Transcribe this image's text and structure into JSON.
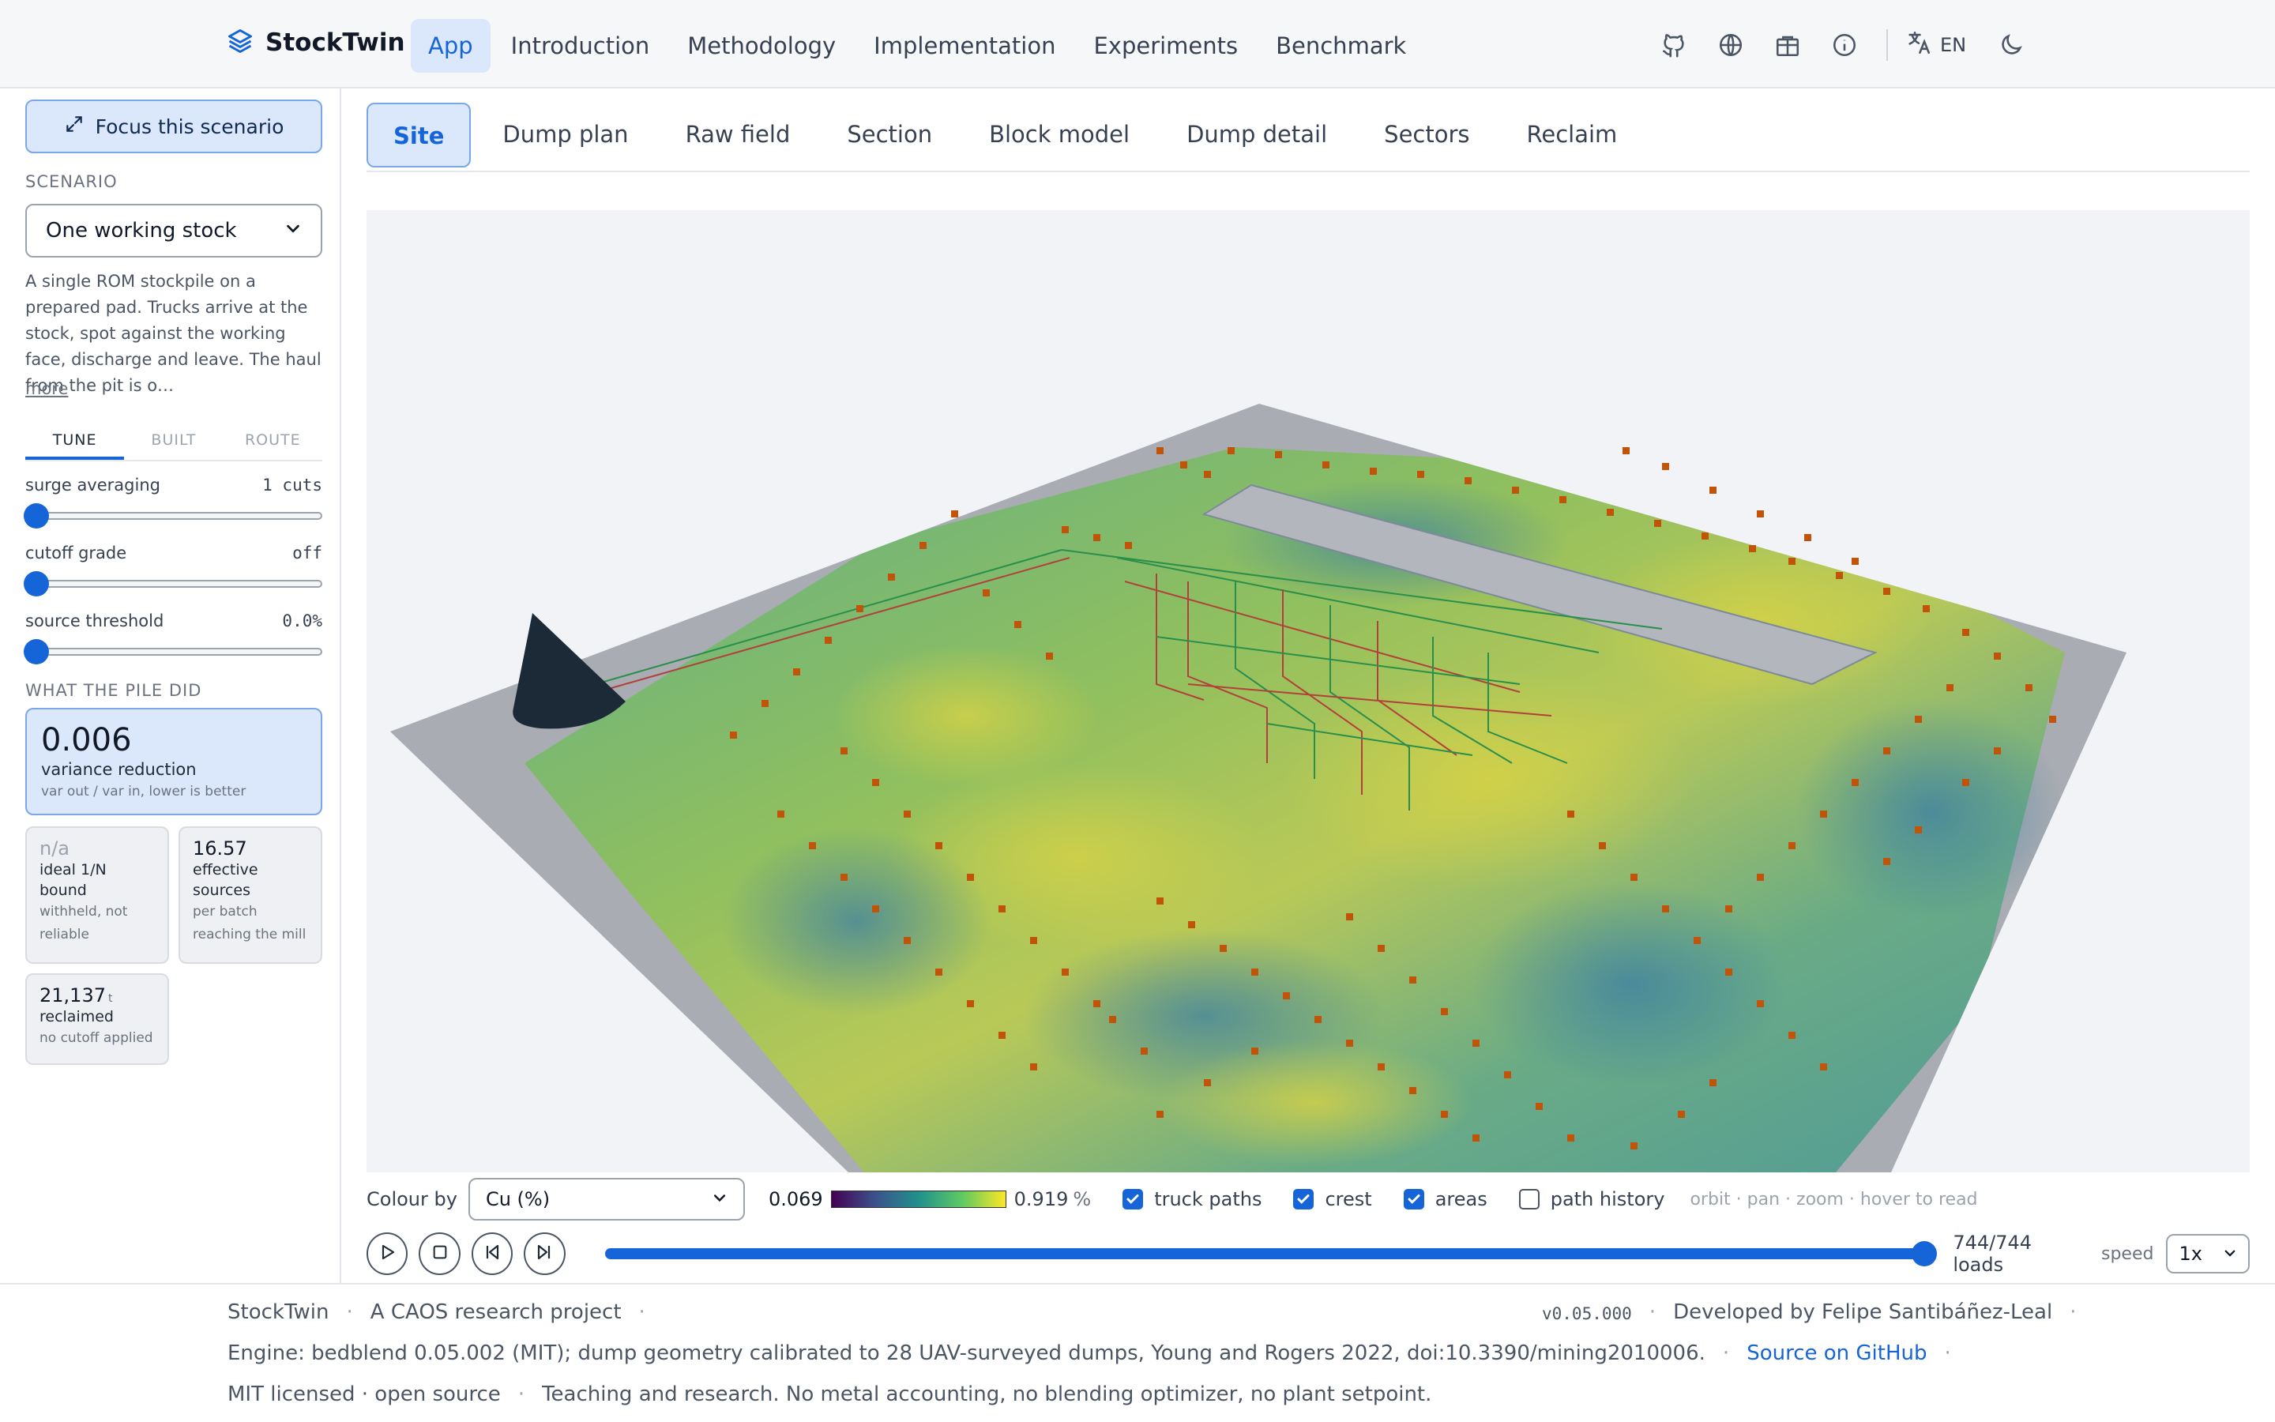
{
  "brand": {
    "name": "StockTwin"
  },
  "nav": {
    "items": [
      "App",
      "Introduction",
      "Methodology",
      "Implementation",
      "Experiments",
      "Benchmark"
    ],
    "active": "App"
  },
  "toolbar": {
    "lang": "EN",
    "icons": [
      "github-icon",
      "globe-icon",
      "gift-icon",
      "info-icon",
      "translate-icon",
      "moon-icon"
    ]
  },
  "sidebar": {
    "focus_label": "Focus this scenario",
    "scenario_label": "SCENARIO",
    "scenario_value": "One working stock",
    "description": "A single ROM stockpile on a prepared pad. Trucks arrive at the stock, spot against the working face, discharge and leave. The haul from the pit is o…",
    "more": "more",
    "tabs": [
      "TUNE",
      "BUILT",
      "ROUTE"
    ],
    "params": [
      {
        "label": "surge averaging",
        "value": "1 cuts",
        "level": 0
      },
      {
        "label": "cutoff grade",
        "value": "off",
        "level": 0
      },
      {
        "label": "source threshold",
        "value": "0.0%",
        "level": 0
      }
    ],
    "results_label": "WHAT THE PILE DID",
    "variance": {
      "value": "0.006",
      "label": "variance reduction",
      "sub": "var out / var in, lower is better"
    },
    "ideal": {
      "value": "n/a",
      "label": "ideal 1/N bound",
      "sub": "withheld, not reliable"
    },
    "effective": {
      "value": "16.57",
      "label": "effective sources",
      "sub": "per batch reaching the mill"
    },
    "reclaimed": {
      "value": "21,137",
      "unit": "t",
      "label": "reclaimed",
      "sub": "no cutoff applied"
    }
  },
  "viewtabs": {
    "items": [
      "Site",
      "Dump plan",
      "Raw field",
      "Section",
      "Block model",
      "Dump detail",
      "Sectors",
      "Reclaim"
    ],
    "active": "Site"
  },
  "controls": {
    "colour_by_label": "Colour by",
    "colour_by_value": "Cu (%)",
    "legend_min": "0.069",
    "legend_max": "0.919",
    "legend_unit": "%",
    "checkboxes": [
      {
        "label": "truck paths",
        "checked": true
      },
      {
        "label": "crest",
        "checked": true
      },
      {
        "label": "areas",
        "checked": true
      },
      {
        "label": "path history",
        "checked": false
      }
    ],
    "hint": "orbit · pan · zoom · hover to read"
  },
  "playback": {
    "loads": "744/744 loads",
    "progress": 1.0,
    "speed_label": "speed",
    "speed_value": "1x"
  },
  "footer": {
    "name": "StockTwin",
    "tagline": "A CAOS research project",
    "version": "v0.05.000",
    "developer": "Developed by Felipe Santibáñez-Leal",
    "engine": "Engine: bedblend 0.05.002 (MIT); dump geometry calibrated to 28 UAV-surveyed dumps, Young and Rogers 2022, doi:10.3390/mining2010006.",
    "source_link": "Source on GitHub",
    "license": "MIT licensed · open source",
    "note": "Teaching and research. No metal accounting, no blending optimizer, no plant setpoint."
  },
  "colors": {
    "accent": "#1565d8",
    "accent_bg": "#dbe8fb",
    "dump_marker": "#c2540a"
  }
}
